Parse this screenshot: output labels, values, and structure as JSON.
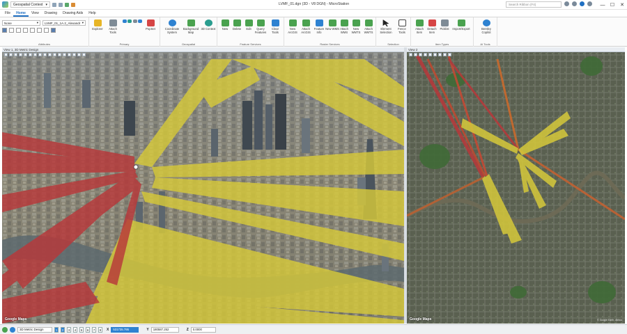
{
  "titlebar": {
    "context": "Geospatial Context",
    "title": "LVMF_01.dgn (3D - V8 DGN) - MicroStation",
    "search_placeholder": "Search Ribbon (F4)",
    "minimize": "—",
    "maximize": "☐",
    "close": "✕"
  },
  "menu": [
    "File",
    "Home",
    "View",
    "Drawing",
    "Drawing Aids",
    "Help"
  ],
  "ribbon": {
    "attributes": {
      "level": "None",
      "model": "LVMF_01_1A.2_Alexandr",
      "label": "Attributes"
    },
    "primary": {
      "label": "Primary",
      "buttons": [
        "Explorer",
        "Attach Tools",
        "PopSet"
      ]
    },
    "geospatial": {
      "label": "Geospatial",
      "buttons": [
        "Coordinate System",
        "Background Map",
        "3D Context"
      ]
    },
    "feature_services": {
      "label": "Feature Services",
      "buttons": [
        "New",
        "Delete",
        "Edit",
        "Query Features",
        "Clear Tools"
      ]
    },
    "raster_services": {
      "label": "Raster Services",
      "buttons": [
        "New ArcGIS",
        "Attach ArcGIS",
        "Feature Info",
        "New WMS",
        "Attach WMS",
        "New WMTS",
        "Attach WMTS"
      ]
    },
    "selection": {
      "label": "Selection",
      "buttons": [
        "Element Selection",
        "Fence Tools"
      ]
    },
    "item_types": {
      "label": "Item Types",
      "buttons": [
        "Attach Item",
        "Detach Item",
        "Picklist",
        "Import/Export"
      ]
    },
    "ai_tools": {
      "label": "AI Tools",
      "buttons": [
        "Bentley Copilot"
      ]
    }
  },
  "views": {
    "left_title": "View 1, 3D Metric Design",
    "right_title": "View 2",
    "google_mark": "Google Maps",
    "right_attrib": "© Google Earth, Airbus"
  },
  "statusbar": {
    "model": "3D Metric Design",
    "views": [
      "1",
      "2",
      "3",
      "4",
      "5",
      "6",
      "7",
      "8"
    ],
    "x_label": "X",
    "x_value": "531735.795",
    "y_label": "Y",
    "y_value": "180587.252",
    "z_label": "Z",
    "z_value": "0.0000"
  },
  "colors": {
    "view_corridor_red": "#b8383a",
    "view_corridor_yellow": "#d6c93a",
    "accent": "#1f6fc2"
  }
}
